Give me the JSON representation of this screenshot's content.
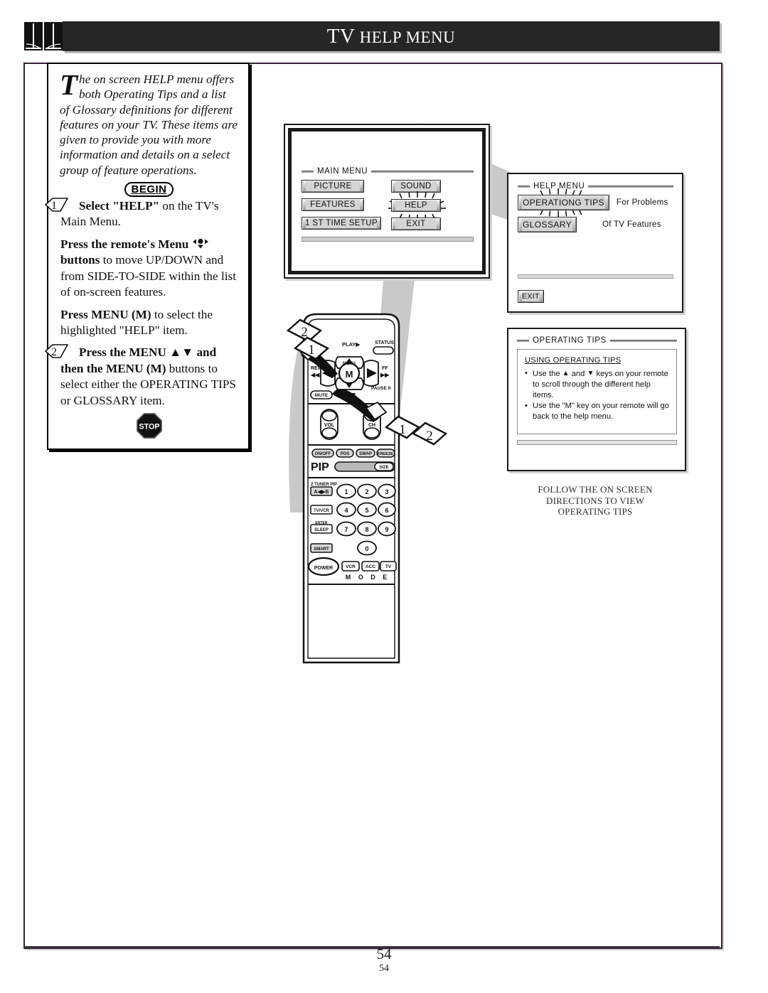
{
  "header": {
    "title_lead": "TV",
    "title_rest": "HELP MENU",
    "title_full": "TV HELP MENU",
    "book_icon": "open-book-icon"
  },
  "intro": {
    "dropcap": "T",
    "text": "he on screen HELP menu offers both Operating Tips and a list of Glossary definitions for different features on your TV. These items are given to provide you with more information and details on a select group of feature operations."
  },
  "begin_label": "BEGIN",
  "stop_label": "STOP",
  "steps": [
    {
      "number": "1",
      "line1_bold": "Select \"HELP\"",
      "line1_rest": " on the TV's Main Menu.",
      "para2_bold": "Press the remote's Menu",
      "para2_icon": "menu-navigation-glyph",
      "para2_bold2": "buttons",
      "para2_rest": " to move UP/DOWN and from SIDE-TO-SIDE within the list of on-screen features.",
      "para3_bold": "Press MENU (M)",
      "para3_rest": " to select the highlighted \"HELP\" item."
    },
    {
      "number": "2",
      "line1_bold": "Press the MENU ▲▼ and then the MENU (M)",
      "line1_rest": " buttons to select either the OPERATING TIPS or GLOSSARY item."
    }
  ],
  "tv_menu": {
    "title": "MAIN MENU",
    "left_buttons": [
      "PICTURE",
      "FEATURES",
      "1 ST TIME SETUP"
    ],
    "right_buttons": [
      "SOUND",
      "HELP",
      "EXIT"
    ],
    "highlighted": "HELP"
  },
  "help_menu": {
    "title": "HELP MENU",
    "items": [
      {
        "label": "OPERATIONG TIPS",
        "note": "For Problems",
        "highlighted": true
      },
      {
        "label": "GLOSSARY",
        "note": "Of TV Features",
        "highlighted": false
      }
    ],
    "exit_label": "EXIT"
  },
  "operating_tips": {
    "title": "OPERATING TIPS",
    "heading": "USING OPERATING TIPS",
    "bullets": [
      {
        "pre": "Use the ",
        "up": "▲",
        "mid": " and ",
        "down": "▼",
        "post": " keys on your remote to scroll through the different help items."
      },
      {
        "pre": "Use the \"M\" key on your remote will go back to the help menu.",
        "up": "",
        "mid": "",
        "down": "",
        "post": ""
      }
    ]
  },
  "caption": {
    "line1": "FOLLOW THE ON SCREEN",
    "line2": "DIRECTIONS TO VIEW",
    "line3": "OPERATING TIPS"
  },
  "remote": {
    "labels": {
      "play": "PLAY",
      "status": "STATUS",
      "menu_center": "M",
      "menu_small": "MENU",
      "rew": "REW",
      "ff": "FF",
      "mute": "MUTE",
      "stop": "STOP",
      "pause": "PAUSE",
      "vol": "VOL",
      "ch": "CH",
      "onoff": "ON/OFF",
      "pos": "POS",
      "swap": "SWAP",
      "freeze": "FREEZE",
      "pip": "PIP",
      "size": "SIZE",
      "tuner_pip": "2 TUNER PIP",
      "tv_vcr": "TV/VCR",
      "enter": "ENTER",
      "sleep": "SLEEP",
      "smart": "SMART",
      "power": "POWER",
      "mode_vcr": "VCR",
      "mode_acc": "ACC",
      "mode_tv": "TV",
      "mode_word": "M O D E",
      "keys": [
        "1",
        "2",
        "3",
        "4",
        "5",
        "6",
        "7",
        "8",
        "9",
        "0"
      ]
    }
  },
  "callouts": {
    "top": [
      "2",
      "1"
    ],
    "bottom": [
      "1",
      "2"
    ]
  },
  "page_number": "54",
  "page_number_small": "54",
  "colors": {
    "title_bar": "#262626",
    "frame": "#332233",
    "swoosh_grey": "#c9c9c9",
    "button_face": "#d4d4d4"
  }
}
